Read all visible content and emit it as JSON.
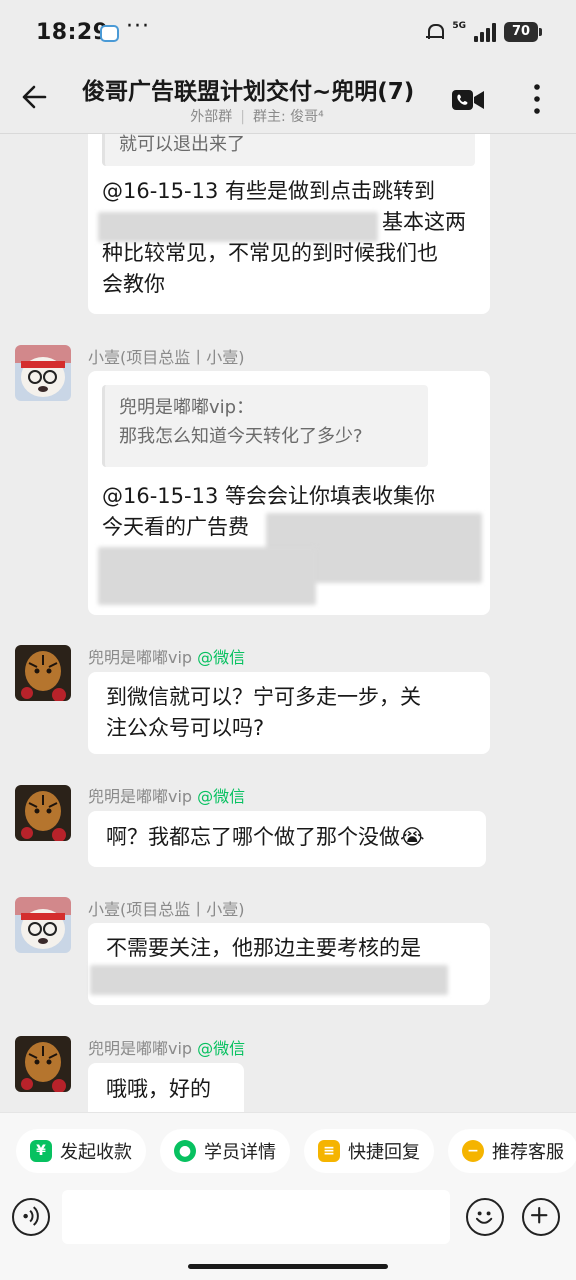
{
  "status_bar": {
    "time": "18:29",
    "network": "5G",
    "battery": "70"
  },
  "header": {
    "title": "俊哥广告联盟计划交付~兜明(7)",
    "group_type": "外部群",
    "owner": "群主: 俊哥⁴"
  },
  "messages": {
    "m1": {
      "quote_tail": "就可以退出来了",
      "text_a": "@16-15-13 有些是做到点击跳转到",
      "text_b": "基本这两",
      "text_c": "种比较常见，不常见的到时候我们也",
      "text_d": "会教你"
    },
    "m2": {
      "sender": "小壹(项目总监丨小壹)",
      "quote_name": "兜明是嘟嘟vip：",
      "quote_text": "那我怎么知道今天转化了多少?",
      "text_a": "@16-15-13 等会会让你填表收集你",
      "text_b": "今天看的广告费"
    },
    "m3": {
      "sender": "兜明是嘟嘟vip",
      "sender_tag": "@微信",
      "text_a": "到微信就可以？宁可多走一步，关",
      "text_b": "注公众号可以吗?"
    },
    "m4": {
      "sender": "兜明是嘟嘟vip",
      "sender_tag": "@微信",
      "text": "啊？我都忘了哪个做了那个没做😭"
    },
    "m5": {
      "sender": "小壹(项目总监丨小壹)",
      "text": "不需要关注，他那边主要考核的是"
    },
    "m6": {
      "sender": "兜明是嘟嘟vip",
      "sender_tag": "@微信",
      "text": "哦哦，好的"
    }
  },
  "quick_actions": {
    "collect": "发起收款",
    "student": "学员详情",
    "reply": "快捷回复",
    "service": "推荐客服"
  },
  "colors": {
    "accent_green": "#07c160",
    "background": "#ededed"
  }
}
